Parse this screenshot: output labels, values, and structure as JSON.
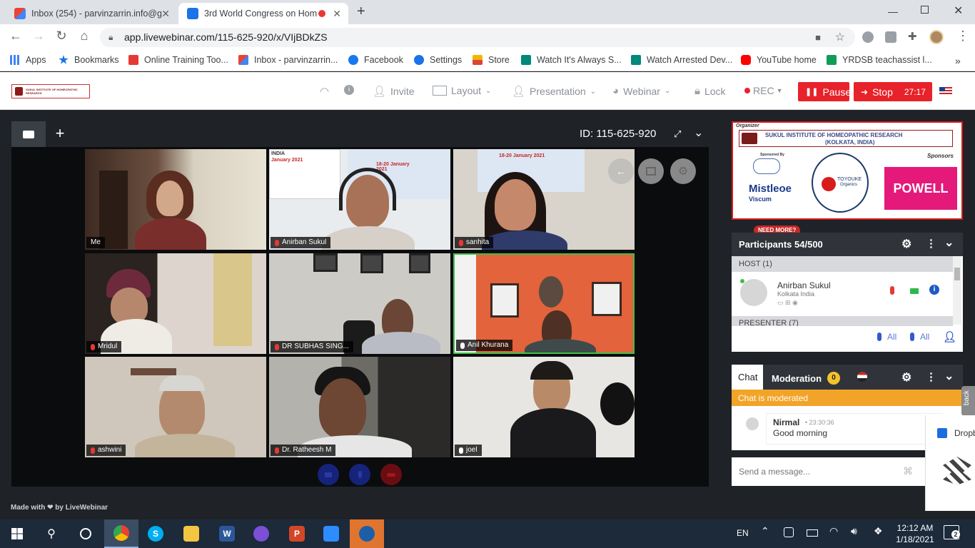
{
  "browser": {
    "tabs": [
      {
        "title": "Inbox (254) - parvinzarrin.info@g",
        "active": false
      },
      {
        "title": "3rd World Congress on Hom",
        "active": true
      }
    ],
    "new_tab": "+",
    "url": "app.livewebinar.com/115-625-920/x/VIjBDkZS",
    "bookmarks": [
      "Apps",
      "Bookmarks",
      "Online Training Too...",
      "Inbox - parvinzarrin...",
      "Facebook",
      "Settings",
      "Store",
      "Watch It's Always S...",
      "Watch Arrested Dev...",
      "YouTube home",
      "YRDSB teachassist l..."
    ],
    "more": "»"
  },
  "app": {
    "logo_text": "SUKUL INSTITUTE OF HOMEOPATHIC RESEARCH",
    "menu": {
      "invite": "Invite",
      "layout": "Layout",
      "presentation": "Presentation",
      "webinar": "Webinar",
      "lock": "Lock",
      "rec": "REC"
    },
    "pause_label": "Pause",
    "stop_label": "Stop",
    "timer": "27:17"
  },
  "stage": {
    "room_id": "ID: 115-625-920",
    "add_label": "+",
    "tiles": [
      {
        "name": "Me",
        "mic": "none"
      },
      {
        "name": "Anirban Sukul",
        "mic": "off"
      },
      {
        "name": "sanhita",
        "mic": "off"
      },
      {
        "name": "Mridul",
        "mic": "off"
      },
      {
        "name": "DR SUBHAS SING...",
        "mic": "off"
      },
      {
        "name": "Anil Khurana",
        "mic": "on"
      },
      {
        "name": "ashwini",
        "mic": "off"
      },
      {
        "name": "Dr. Ratheesh M",
        "mic": "off"
      },
      {
        "name": "joel",
        "mic": "on"
      }
    ],
    "slide_texts": {
      "t2a": "INDIA",
      "t2b": "January 2021",
      "t2c": "18-20 January 2021",
      "t3a": "18-20 January 2021"
    }
  },
  "sponsor": {
    "organizer": "Organizer",
    "institute": "SUKUL INSTITUTE OF HOMEOPATHIC RESEARCH",
    "location": "(KOLKATA, INDIA)",
    "sponsored_by": "Sponsored By",
    "sponsors": "Sponsors",
    "mistleoe": "Mistleoe",
    "viscum": "Viscum",
    "toyouke": "TOYOUKE",
    "organics": "Organics",
    "powell": "POWELL"
  },
  "participants": {
    "need_more": "NEED MORE?",
    "title": "Participants 54/500",
    "host_group": "HOST (1)",
    "host_name": "Anirban Sukul",
    "host_location": "Kolkata India",
    "presenter_group": "PRESENTER (7)",
    "all_label_1": "All",
    "all_label_2": "All"
  },
  "chat": {
    "tab_chat": "Chat",
    "tab_moderation": "Moderation",
    "moderation_count": "0",
    "moderated_banner": "Chat is moderated",
    "messages": [
      {
        "author": "Nirmal",
        "time": "23:30:36",
        "text": "Good morning"
      }
    ],
    "placeholder": "Send a message...",
    "back_label": "back"
  },
  "dropbox": {
    "label": "Dropb"
  },
  "footer": {
    "made_with": "Made with",
    "by": "by",
    "brand": "LiveWebinar"
  },
  "taskbar": {
    "lang": "EN",
    "time": "12:12 AM",
    "date": "1/18/2021",
    "notifications": "2"
  }
}
